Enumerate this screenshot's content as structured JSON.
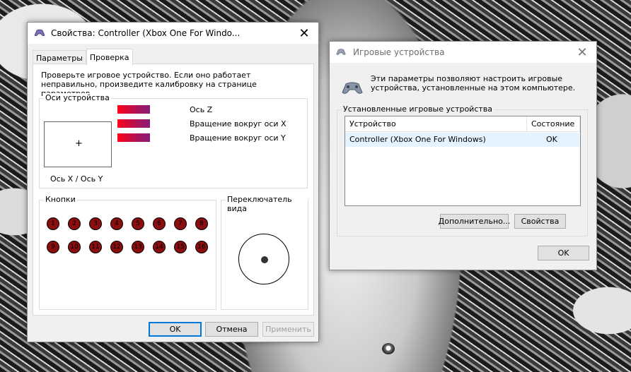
{
  "colors": {
    "accent": "#0078d7",
    "bar_start": "#ff0018",
    "bar_end": "#8b1a7a",
    "button_dot": "#8a0e0e"
  },
  "properties_window": {
    "title": "Свойства: Controller (Xbox One For Windo...",
    "close_glyph": "✕",
    "tabs": [
      {
        "label": "Параметры"
      },
      {
        "label": "Проверка"
      }
    ],
    "active_tab": "Проверка",
    "intro": "Проверьте игровое устройство. Если оно работает неправильно, произведите калибровку на странице параметров.",
    "axes_group": {
      "label": "Оси устройства",
      "crosshair": "+",
      "xy_label": "Ось X / Ось Y",
      "axes": [
        {
          "label": "Ось Z",
          "value": 1.0
        },
        {
          "label": "Вращение вокруг оси X",
          "value": 1.0
        },
        {
          "label": "Вращение вокруг оси Y",
          "value": 1.0
        }
      ]
    },
    "buttons_group": {
      "label": "Кнопки",
      "numbers": [
        "1",
        "2",
        "3",
        "4",
        "5",
        "6",
        "7",
        "8",
        "9",
        "10",
        "11",
        "12",
        "13",
        "14",
        "15",
        "16"
      ]
    },
    "pov_group": {
      "label": "Переключатель вида"
    },
    "ok_label": "OK",
    "cancel_label": "Отмена",
    "apply_label": "Применить"
  },
  "game_devices_window": {
    "title": "Игровые устройства",
    "close_glyph": "✕",
    "description": "Эти параметры позволяют настроить игровые устройства, установленные на этом компьютере.",
    "installed_label": "Установленные игровые устройства",
    "columns": {
      "device": "Устройство",
      "status": "Состояние"
    },
    "rows": [
      {
        "device": "Controller (Xbox One For Windows)",
        "status": "OK"
      }
    ],
    "advanced_label": "Дополнительно...",
    "properties_label": "Свойства",
    "ok_label": "OK"
  }
}
